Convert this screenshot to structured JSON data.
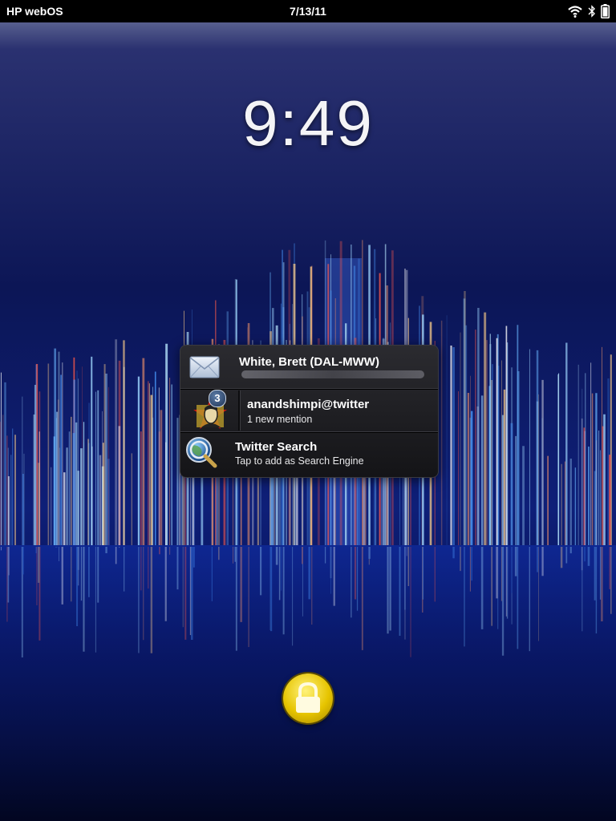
{
  "statusbar": {
    "title": "HP webOS",
    "date": "7/13/11",
    "icons": [
      "wifi-icon",
      "bluetooth-icon",
      "battery-icon"
    ]
  },
  "lockscreen": {
    "time": "9:49"
  },
  "notifications": [
    {
      "id": "email",
      "title": "White, Brett (DAL-MWW)",
      "subtitle": "",
      "icon": "envelope-icon"
    },
    {
      "id": "twitter",
      "title": "anandshimpi@twitter",
      "subtitle": "1 new mention",
      "badge": "3",
      "icon": "twitter-avatar"
    },
    {
      "id": "search",
      "title": "Twitter Search",
      "subtitle": "Tap to add as Search Engine",
      "icon": "search-globe-icon"
    }
  ],
  "colors": {
    "statusbar_bg": "#000000",
    "wallpaper_sky": "#0a0f4a",
    "lock_button": "#e6c400"
  }
}
